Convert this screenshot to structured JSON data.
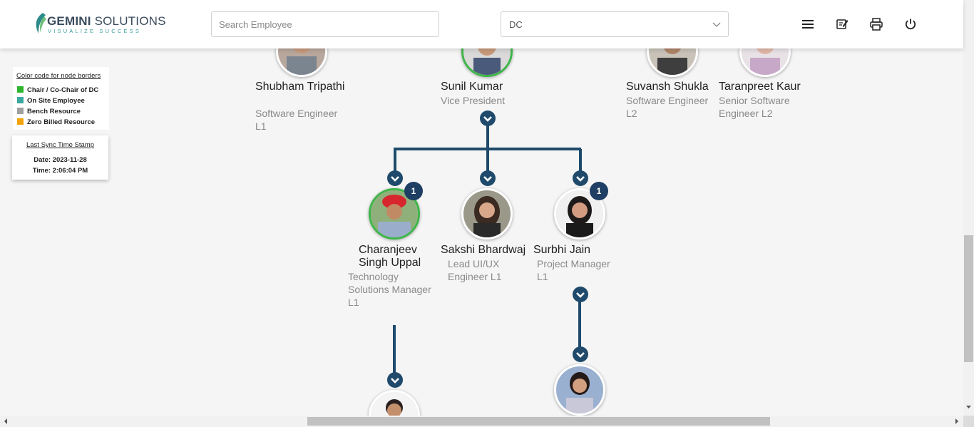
{
  "header": {
    "logo_brand": "GEMINI",
    "logo_rest": "SOLUTIONS",
    "logo_tagline": "VISUALIZE SUCCESS",
    "search_placeholder": "Search Employee",
    "selected_department": "DC",
    "icons": [
      "menu-icon",
      "notes-icon",
      "print-icon",
      "power-icon"
    ]
  },
  "legend": {
    "title": "Color code for node borders",
    "items": [
      {
        "label": "Chair / Co-Chair of DC",
        "color": "#2db52d"
      },
      {
        "label": "On Site Employee",
        "color": "#3aa7a0"
      },
      {
        "label": "Bench Resource",
        "color": "#a0a0a0"
      },
      {
        "label": "Zero Billed Resource",
        "color": "#f2a20a"
      }
    ]
  },
  "sync": {
    "title": "Last Sync Time Stamp",
    "date": "Date: 2023-11-28",
    "time": "Time: 2:06:04 PM"
  },
  "tree": {
    "line_color": "#1f4a6b",
    "top_row": [
      {
        "name": "Shubham Tripathi",
        "role": "Software Engineer L1"
      },
      {
        "name": "Sunil Kumar",
        "role": "Vice President"
      },
      {
        "name": "Suvansh Shukla",
        "role": "Software Engineer L2"
      },
      {
        "name": "Taranpreet Kaur",
        "role": "Senior Software Engineer L2"
      }
    ],
    "children": [
      {
        "name": "Charanjeev Singh Uppal",
        "role": "Technology Solutions Manager L1",
        "badge": "1"
      },
      {
        "name": "Sakshi Bhardwaj",
        "role": "Lead UI/UX Engineer L1"
      },
      {
        "name": "Surbhi Jain",
        "role": "Project Manager L1",
        "badge": "1"
      }
    ]
  }
}
